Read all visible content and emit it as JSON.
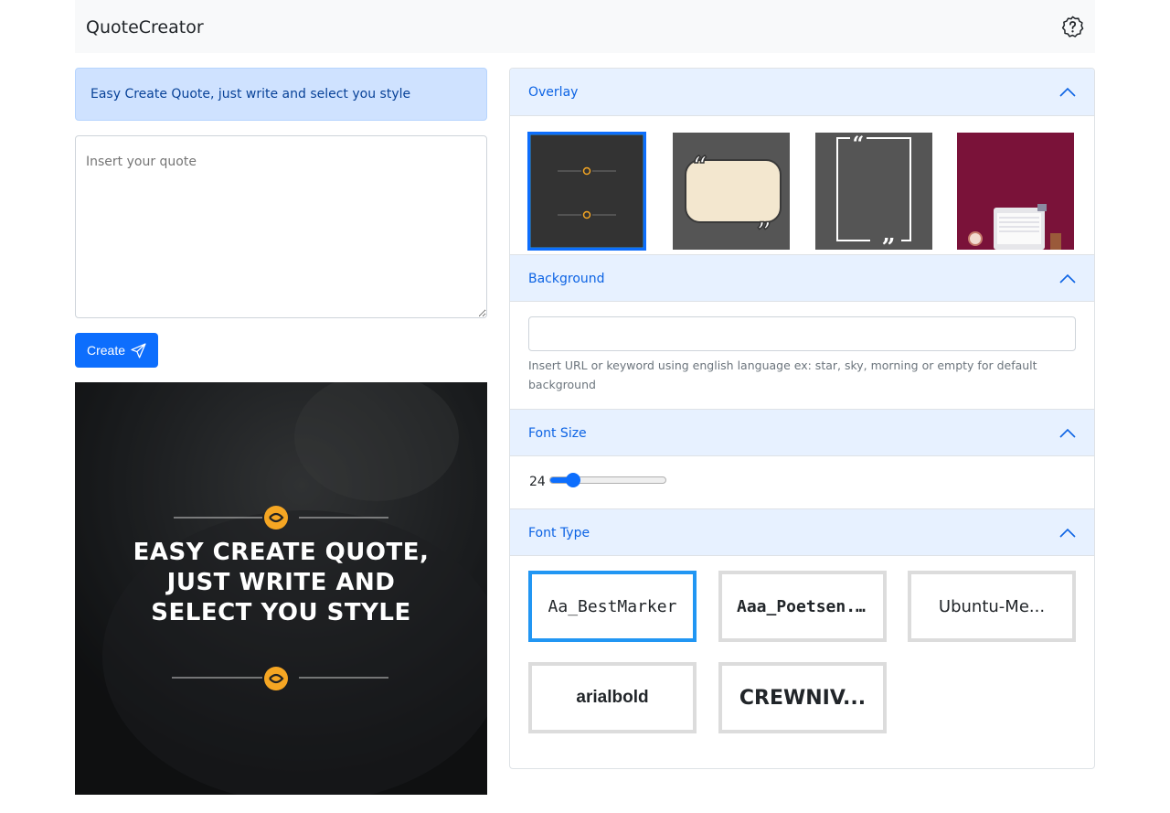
{
  "header": {
    "brand": "QuoteCreator",
    "help_icon": "help-circle-icon"
  },
  "left": {
    "info_text": "Easy Create Quote, just write and select you style",
    "quote_placeholder": "Insert your quote",
    "create_label": "Create",
    "create_icon": "send-icon",
    "preview_quote": "EASY CREATE QUOTE, JUST WRITE AND SELECT YOU STYLE"
  },
  "sections": {
    "overlay": {
      "title": "Overlay",
      "selected_index": 0
    },
    "background": {
      "title": "Background",
      "input_value": "",
      "help": "Insert URL or keyword using english language ex: star, sky, morning or empty for default background"
    },
    "font_size": {
      "title": "Font Size",
      "value": 24,
      "min": 10,
      "max": 100
    },
    "font_type": {
      "title": "Font Type",
      "fonts": [
        {
          "label": "Aa_BestMarker",
          "selected": true
        },
        {
          "label": "Aaa_Poetsen...",
          "selected": false
        },
        {
          "label": "Ubuntu-Me...",
          "selected": false
        },
        {
          "label": "arialbold",
          "selected": false
        },
        {
          "label": "CREWNIV...",
          "selected": false
        }
      ]
    }
  },
  "colors": {
    "primary": "#0d6efd",
    "accordion_header": "#e7f1ff",
    "accent_orange": "#f5a623"
  }
}
